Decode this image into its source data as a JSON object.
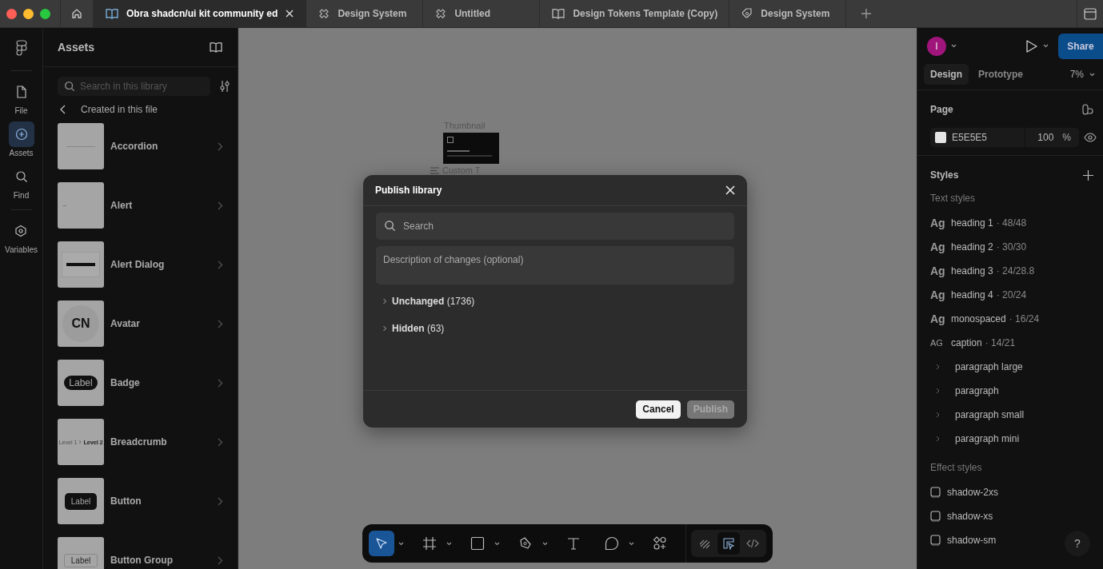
{
  "tabs": [
    {
      "label": "Obra shadcn/ui kit community ed",
      "kind": "library",
      "selected": true
    },
    {
      "label": "Design System",
      "kind": "design",
      "selected": false
    },
    {
      "label": "Untitled",
      "kind": "design",
      "selected": false
    },
    {
      "label": "Design Tokens Template (Copy)",
      "kind": "library",
      "selected": false
    },
    {
      "label": "Design System",
      "kind": "slides",
      "selected": false
    }
  ],
  "rail": [
    {
      "label": "File",
      "kind": "file",
      "selected": false
    },
    {
      "label": "Assets",
      "kind": "assets",
      "selected": true
    },
    {
      "label": "Find",
      "kind": "find",
      "selected": false
    },
    {
      "label": "Variables",
      "kind": "variables",
      "selected": false
    }
  ],
  "assets": {
    "title": "Assets",
    "search_placeholder": "Search in this library",
    "breadcrumb": "Created in this file",
    "items": [
      {
        "name": "Accordion",
        "kind": "line"
      },
      {
        "name": "Alert",
        "kind": "alert"
      },
      {
        "name": "Alert Dialog",
        "kind": "dialog"
      },
      {
        "name": "Avatar",
        "kind": "avatar",
        "preview_text": "CN"
      },
      {
        "name": "Badge",
        "kind": "badge",
        "preview_text": "Label"
      },
      {
        "name": "Breadcrumb",
        "kind": "breadcrumb",
        "preview_text": "Level 1",
        "preview_text_2": "Level 2"
      },
      {
        "name": "Button",
        "kind": "button",
        "preview_text": "Label"
      },
      {
        "name": "Button Group",
        "kind": "group",
        "preview_text": "Label"
      }
    ]
  },
  "canvas": {
    "frame_label": "Thumbnail",
    "layer_label": "Custom T"
  },
  "dialog": {
    "title": "Publish library",
    "search_placeholder": "Search",
    "description_placeholder": "Description of changes (optional)",
    "groups": [
      {
        "label": "**Unchanged** (1736)",
        "expanded": false
      },
      {
        "label": "**Hidden** (63)",
        "expanded": false
      }
    ],
    "buttons": [
      {
        "label": "Cancel",
        "disabled": false
      },
      {
        "label": "Publish",
        "disabled": true
      }
    ]
  },
  "toolbar": {
    "tools": [
      {
        "kind": "move",
        "selected": true,
        "menu": true
      },
      {
        "kind": "frame",
        "selected": false,
        "menu": true
      },
      {
        "kind": "shape",
        "selected": false,
        "menu": true
      },
      {
        "kind": "pen",
        "selected": false,
        "menu": true
      },
      {
        "kind": "text",
        "selected": false,
        "menu": false
      },
      {
        "kind": "comment",
        "selected": false,
        "menu": true
      },
      {
        "kind": "actions",
        "selected": false,
        "menu": false
      }
    ],
    "modes": [
      {
        "kind": "draw",
        "selected": false
      },
      {
        "kind": "design",
        "selected": true
      },
      {
        "kind": "dev",
        "selected": false
      }
    ]
  },
  "right": {
    "avatar": "I",
    "share": "Share",
    "tabs": [
      {
        "label": "Design",
        "selected": true
      },
      {
        "label": "Prototype",
        "selected": false
      }
    ],
    "zoom": "7%",
    "page_title": "Page",
    "page_color": "E5E5E5",
    "page_opacity": "100",
    "percent": "%",
    "styles_title": "Styles",
    "text_styles_title": "Text styles",
    "text_styles": [
      {
        "kind": "style",
        "glyph": "Ag",
        "name": "heading 1",
        "meta": "· 48/48"
      },
      {
        "kind": "style",
        "glyph": "Ag",
        "name": "heading 2",
        "meta": "· 30/30"
      },
      {
        "kind": "style",
        "glyph": "Ag",
        "name": "heading 3",
        "meta": "· 24/28.8"
      },
      {
        "kind": "style",
        "glyph": "Ag",
        "name": "heading 4",
        "meta": "· 20/24"
      },
      {
        "kind": "style",
        "glyph": "Ag",
        "name": "monospaced",
        "meta": "· 16/24"
      },
      {
        "kind": "style",
        "glyph": "AG",
        "name": "caption",
        "meta": "· 14/21"
      },
      {
        "kind": "folder",
        "name": "paragraph large"
      },
      {
        "kind": "folder",
        "name": "paragraph"
      },
      {
        "kind": "folder",
        "name": "paragraph small"
      },
      {
        "kind": "folder",
        "name": "paragraph mini"
      }
    ],
    "effect_styles_title": "Effect styles",
    "effect_styles": [
      "shadow-2xs",
      "shadow-xs",
      "shadow-sm"
    ],
    "help": "?"
  }
}
